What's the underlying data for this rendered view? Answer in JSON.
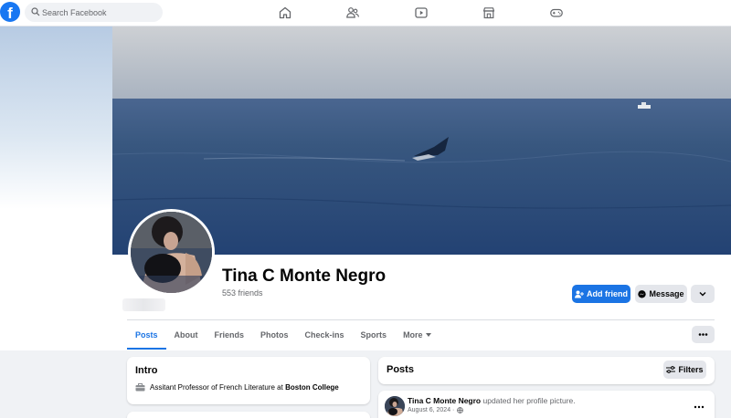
{
  "topbar": {
    "logo": "f",
    "search_placeholder": "Search Facebook",
    "nav_icons": [
      "home-icon",
      "friends-icon",
      "video-icon",
      "marketplace-icon",
      "gaming-icon"
    ]
  },
  "profile": {
    "name": "Tina C Monte Negro",
    "friends": "553 friends",
    "add_friend_label": "Add friend",
    "message_label": "Message"
  },
  "tabs": [
    "Posts",
    "About",
    "Friends",
    "Photos",
    "Check-ins",
    "Sports",
    "More"
  ],
  "intro": {
    "title": "Intro",
    "work_text": "Assitant Professor of French Literature at ",
    "work_org": "Boston College"
  },
  "posts": {
    "title": "Posts",
    "filters_label": "Filters",
    "post": {
      "author": "Tina C Monte Negro",
      "action": "updated her profile picture.",
      "date": "August 6, 2024 ·"
    }
  },
  "colors": {
    "brand": "#1877f2",
    "primary_button": "#1b74e4",
    "background": "#f0f2f5"
  }
}
